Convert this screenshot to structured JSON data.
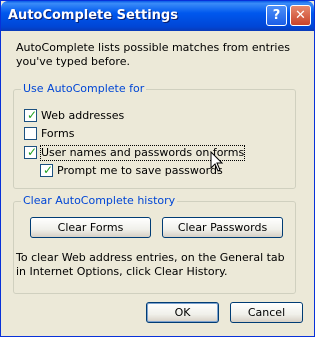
{
  "window": {
    "title": "AutoComplete Settings",
    "help_label": "?",
    "close_label": "✕"
  },
  "intro": "AutoComplete lists possible matches from entries you've typed before.",
  "use_group": {
    "legend": "Use AutoComplete for",
    "options": [
      {
        "label": "Web addresses",
        "checked": true
      },
      {
        "label": "Forms",
        "checked": false
      },
      {
        "label": "User names and passwords on forms",
        "checked": true
      },
      {
        "label": "Prompt me to save passwords",
        "checked": true
      }
    ]
  },
  "clear_group": {
    "legend": "Clear AutoComplete history",
    "clear_forms": "Clear Forms",
    "clear_passwords": "Clear Passwords",
    "help_text": "To clear Web address entries, on the General tab in Internet Options, click Clear History."
  },
  "buttons": {
    "ok": "OK",
    "cancel": "Cancel"
  },
  "colors": {
    "titlebar": "#0058ee",
    "accent": "#0046d5",
    "check": "#21a121"
  }
}
